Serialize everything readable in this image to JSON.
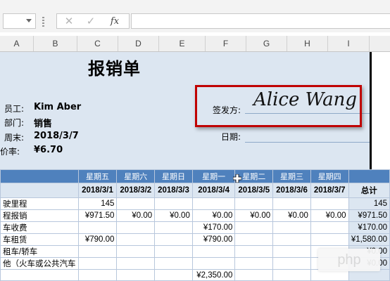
{
  "formula_bar": {
    "cancel_icon": "✕",
    "enter_icon": "✓",
    "fx_label": "fx",
    "content": ""
  },
  "columns": [
    "A",
    "B",
    "C",
    "D",
    "E",
    "F",
    "G",
    "H",
    "I"
  ],
  "title": "报销单",
  "header": {
    "employee_label": "员工:",
    "employee_value": "Kim Aber",
    "dept_label": "部门:",
    "dept_value": "销售",
    "weekend_label": "周末:",
    "weekend_value": "2018/3/7",
    "rate_label": "价率:",
    "rate_value": "¥6.70",
    "signer_label": "签发方:",
    "signature": "Alice Wang",
    "date_label": "日期:"
  },
  "table": {
    "days": [
      "星期五",
      "星期六",
      "星期日",
      "星期一",
      "星期二",
      "星期三",
      "星期四"
    ],
    "dates": [
      "2018/3/1",
      "2018/3/2",
      "2018/3/3",
      "2018/3/4",
      "2018/3/5",
      "2018/3/6",
      "2018/3/7"
    ],
    "total_label": "总计",
    "rows": [
      {
        "label": "驶里程",
        "cells": [
          "145",
          "",
          "",
          "",
          "",
          "",
          ""
        ],
        "total": "145"
      },
      {
        "label": "程报销",
        "cells": [
          "¥971.50",
          "¥0.00",
          "¥0.00",
          "¥0.00",
          "¥0.00",
          "¥0.00",
          "¥0.00"
        ],
        "total": "¥971.50"
      },
      {
        "label": "车收费",
        "cells": [
          "",
          "",
          "",
          "¥170.00",
          "",
          "",
          ""
        ],
        "total": "¥170.00"
      },
      {
        "label": "车租赁",
        "cells": [
          "¥790.00",
          "",
          "",
          "¥790.00",
          "",
          "",
          ""
        ],
        "total": "¥1,580.00"
      },
      {
        "label": "租车/轿车",
        "cells": [
          "",
          "",
          "",
          "",
          "",
          "",
          ""
        ],
        "total": "¥0.00"
      },
      {
        "label": "他（火车或公共汽车",
        "cells": [
          "",
          "",
          "",
          "",
          "",
          "",
          ""
        ],
        "total": "¥0.00"
      },
      {
        "label": "",
        "cells": [
          "",
          "",
          "",
          "¥2,350.00",
          "",
          "",
          ""
        ],
        "total": ""
      }
    ]
  },
  "watermark": "php",
  "colors": {
    "header_blue": "#4f81bd",
    "sheet_bg": "#dce6f1",
    "highlight_red": "#c00000"
  }
}
